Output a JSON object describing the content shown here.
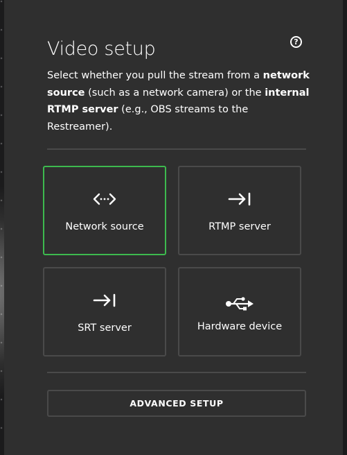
{
  "dialog": {
    "title": "Video setup",
    "help_icon": "question-circle-icon",
    "help_glyph": "?",
    "description": [
      {
        "text": "Select whether you pull the stream from a ",
        "bold": false
      },
      {
        "text": "network source",
        "bold": true
      },
      {
        "text": " (such as a network camera) or the ",
        "bold": false
      },
      {
        "text": "internal RTMP server",
        "bold": true
      },
      {
        "text": " (e.g., OBS streams to the Restreamer).",
        "bold": false
      }
    ]
  },
  "options": [
    {
      "label": "Network source",
      "icon": "code-arrows-icon",
      "selected": true
    },
    {
      "label": "RTMP server",
      "icon": "arrow-to-right-icon",
      "selected": false
    },
    {
      "label": "SRT server",
      "icon": "arrow-to-right-icon",
      "selected": false
    },
    {
      "label": "Hardware device",
      "icon": "usb-icon",
      "selected": false
    }
  ],
  "advanced_button": {
    "label": "ADVANCED SETUP"
  },
  "colors": {
    "panel_bg": "#2f2f2f",
    "border": "#4a4a4a",
    "selected_border": "#3dba4e",
    "text": "#ffffff"
  }
}
